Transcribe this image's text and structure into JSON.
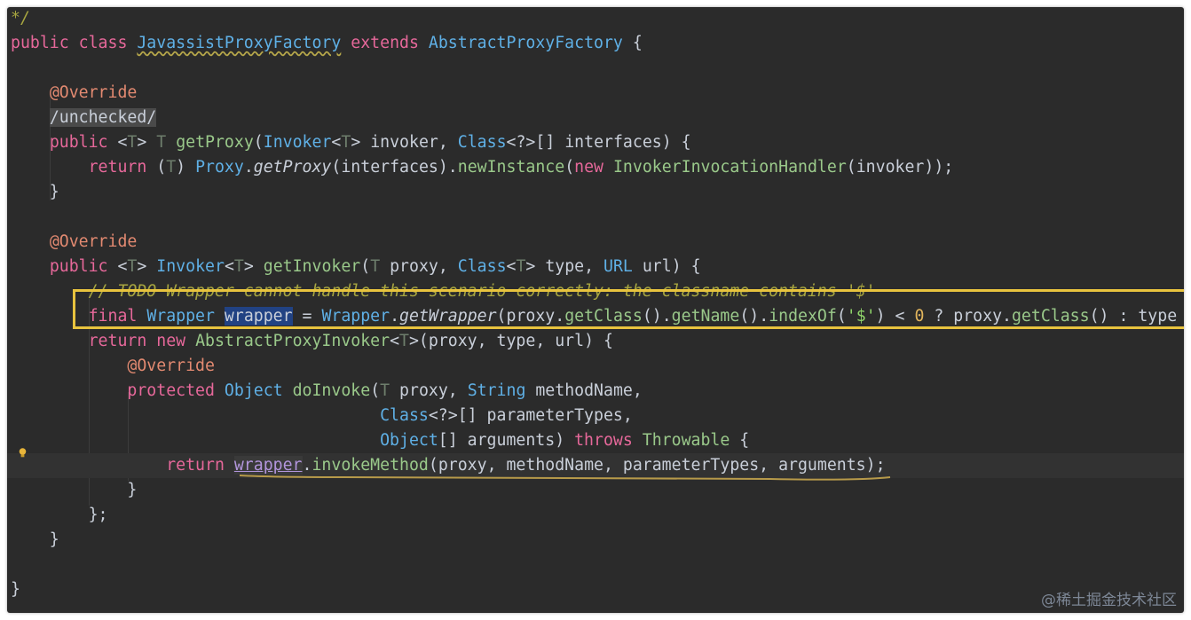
{
  "editor": {
    "lines": [
      {
        "id": "l0",
        "tokens": [
          {
            "c": "cmt",
            "t": "*/"
          }
        ]
      },
      {
        "id": "l1",
        "tokens": [
          {
            "c": "kw",
            "t": "public"
          },
          {
            "c": "pln",
            "t": " "
          },
          {
            "c": "kw",
            "t": "class"
          },
          {
            "c": "pln",
            "t": " "
          },
          {
            "c": "cwavy",
            "t": "JavassistProxyFactory"
          },
          {
            "c": "pln",
            "t": " "
          },
          {
            "c": "kw",
            "t": "extends"
          },
          {
            "c": "pln",
            "t": " "
          },
          {
            "c": "cls",
            "t": "AbstractProxyFactory"
          },
          {
            "c": "pln",
            "t": " {"
          }
        ]
      },
      {
        "id": "l2",
        "tokens": []
      },
      {
        "id": "l3",
        "tokens": [
          {
            "c": "pln",
            "t": "    "
          },
          {
            "c": "ann",
            "t": "@Override"
          }
        ]
      },
      {
        "id": "l4",
        "tokens": [
          {
            "c": "pln",
            "t": "    "
          },
          {
            "c": "boxed pln",
            "t": "/unchecked/"
          }
        ]
      },
      {
        "id": "l5",
        "tokens": [
          {
            "c": "pln",
            "t": "    "
          },
          {
            "c": "kw",
            "t": "public"
          },
          {
            "c": "pln",
            "t": " <"
          },
          {
            "c": "tp",
            "t": "T"
          },
          {
            "c": "pln",
            "t": "> "
          },
          {
            "c": "tp",
            "t": "T"
          },
          {
            "c": "pln",
            "t": " "
          },
          {
            "c": "fn",
            "t": "getProxy"
          },
          {
            "c": "pln",
            "t": "("
          },
          {
            "c": "cls",
            "t": "Invoker"
          },
          {
            "c": "pln",
            "t": "<"
          },
          {
            "c": "tp",
            "t": "T"
          },
          {
            "c": "pln",
            "t": "> invoker, "
          },
          {
            "c": "cls",
            "t": "Class"
          },
          {
            "c": "pln",
            "t": "<?>[] interfaces) {"
          }
        ]
      },
      {
        "id": "l6",
        "tokens": [
          {
            "c": "pln",
            "t": "        "
          },
          {
            "c": "kw",
            "t": "return"
          },
          {
            "c": "pln",
            "t": " ("
          },
          {
            "c": "tp",
            "t": "T"
          },
          {
            "c": "pln",
            "t": ") "
          },
          {
            "c": "cls",
            "t": "Proxy"
          },
          {
            "c": "pln",
            "t": "."
          },
          {
            "c": "pln st",
            "t": "getProxy"
          },
          {
            "c": "pln",
            "t": "(interfaces)."
          },
          {
            "c": "fn",
            "t": "newInstance"
          },
          {
            "c": "pln",
            "t": "("
          },
          {
            "c": "kw",
            "t": "new"
          },
          {
            "c": "pln",
            "t": " "
          },
          {
            "c": "fn",
            "t": "InvokerInvocationHandler"
          },
          {
            "c": "pln",
            "t": "(invoker));"
          }
        ]
      },
      {
        "id": "l7",
        "tokens": [
          {
            "c": "pln",
            "t": "    }"
          }
        ]
      },
      {
        "id": "l8",
        "tokens": []
      },
      {
        "id": "l9",
        "tokens": [
          {
            "c": "pln",
            "t": "    "
          },
          {
            "c": "ann",
            "t": "@Override"
          }
        ]
      },
      {
        "id": "l10",
        "tokens": [
          {
            "c": "pln",
            "t": "    "
          },
          {
            "c": "kw",
            "t": "public"
          },
          {
            "c": "pln",
            "t": " <"
          },
          {
            "c": "tp",
            "t": "T"
          },
          {
            "c": "pln",
            "t": "> "
          },
          {
            "c": "cls",
            "t": "Invoker"
          },
          {
            "c": "pln",
            "t": "<"
          },
          {
            "c": "tp",
            "t": "T"
          },
          {
            "c": "pln",
            "t": "> "
          },
          {
            "c": "fn",
            "t": "getInvoker"
          },
          {
            "c": "pln",
            "t": "("
          },
          {
            "c": "tp",
            "t": "T"
          },
          {
            "c": "pln",
            "t": " proxy, "
          },
          {
            "c": "cls",
            "t": "Class"
          },
          {
            "c": "pln",
            "t": "<"
          },
          {
            "c": "tp",
            "t": "T"
          },
          {
            "c": "pln",
            "t": "> type, "
          },
          {
            "c": "cls",
            "t": "URL"
          },
          {
            "c": "pln",
            "t": " url) {"
          }
        ]
      },
      {
        "id": "l11",
        "tokens": [
          {
            "c": "pln",
            "t": "        "
          },
          {
            "c": "cmt",
            "t": "// TODO Wrapper cannot handle this scenario correctly: the classname contains '$'"
          }
        ]
      },
      {
        "id": "l12",
        "tokens": [
          {
            "c": "pln",
            "t": "        "
          },
          {
            "c": "kw",
            "t": "final"
          },
          {
            "c": "pln",
            "t": " "
          },
          {
            "c": "cls",
            "t": "Wrapper"
          },
          {
            "c": "pln",
            "t": " "
          },
          {
            "c": "hl pln",
            "t": "wrapper"
          },
          {
            "c": "pln",
            "t": " = "
          },
          {
            "c": "cls",
            "t": "Wrapper"
          },
          {
            "c": "pln",
            "t": "."
          },
          {
            "c": "pln st",
            "t": "getWrapper"
          },
          {
            "c": "pln",
            "t": "(proxy."
          },
          {
            "c": "fn",
            "t": "getClass"
          },
          {
            "c": "pln",
            "t": "()."
          },
          {
            "c": "fn",
            "t": "getName"
          },
          {
            "c": "pln",
            "t": "()."
          },
          {
            "c": "fn",
            "t": "indexOf"
          },
          {
            "c": "pln",
            "t": "("
          },
          {
            "c": "str",
            "t": "'$'"
          },
          {
            "c": "pln",
            "t": ") < "
          },
          {
            "c": "num",
            "t": "0"
          },
          {
            "c": "pln",
            "t": " ? proxy."
          },
          {
            "c": "fn",
            "t": "getClass"
          },
          {
            "c": "pln",
            "t": "() : type"
          }
        ]
      },
      {
        "id": "l13",
        "tokens": [
          {
            "c": "pln",
            "t": "        "
          },
          {
            "c": "kw",
            "t": "return"
          },
          {
            "c": "pln",
            "t": " "
          },
          {
            "c": "kw",
            "t": "new"
          },
          {
            "c": "pln",
            "t": " "
          },
          {
            "c": "fn",
            "t": "AbstractProxyInvoker"
          },
          {
            "c": "pln",
            "t": "<"
          },
          {
            "c": "tp",
            "t": "T"
          },
          {
            "c": "pln",
            "t": ">(proxy, type, url) {"
          }
        ]
      },
      {
        "id": "l14",
        "tokens": [
          {
            "c": "pln",
            "t": "            "
          },
          {
            "c": "ann",
            "t": "@Override"
          }
        ]
      },
      {
        "id": "l15",
        "tokens": [
          {
            "c": "pln",
            "t": "            "
          },
          {
            "c": "kw",
            "t": "protected"
          },
          {
            "c": "pln",
            "t": " "
          },
          {
            "c": "cls",
            "t": "Object"
          },
          {
            "c": "pln",
            "t": " "
          },
          {
            "c": "fn",
            "t": "doInvoke"
          },
          {
            "c": "pln",
            "t": "("
          },
          {
            "c": "tp",
            "t": "T"
          },
          {
            "c": "pln",
            "t": " proxy, "
          },
          {
            "c": "cls",
            "t": "String"
          },
          {
            "c": "pln",
            "t": " methodName,"
          }
        ]
      },
      {
        "id": "l16",
        "tokens": [
          {
            "c": "pln",
            "t": "                                      "
          },
          {
            "c": "cls",
            "t": "Class"
          },
          {
            "c": "pln",
            "t": "<?>[] parameterTypes,"
          }
        ]
      },
      {
        "id": "l17",
        "tokens": [
          {
            "c": "pln",
            "t": "                                      "
          },
          {
            "c": "cls",
            "t": "Object"
          },
          {
            "c": "pln",
            "t": "[] arguments) "
          },
          {
            "c": "kw",
            "t": "throws"
          },
          {
            "c": "pln",
            "t": " "
          },
          {
            "c": "fn",
            "t": "Throwable"
          },
          {
            "c": "pln",
            "t": " {"
          }
        ]
      },
      {
        "id": "l18",
        "cur": true,
        "tokens": [
          {
            "c": "pln",
            "t": "                "
          },
          {
            "c": "kw",
            "t": "return"
          },
          {
            "c": "pln",
            "t": " "
          },
          {
            "c": "ulink",
            "t": "wrapper"
          },
          {
            "c": "pln",
            "t": "."
          },
          {
            "c": "fn",
            "t": "invokeMethod"
          },
          {
            "c": "pln",
            "t": "(proxy, methodName, parameterTypes, arguments);"
          }
        ]
      },
      {
        "id": "l19",
        "tokens": [
          {
            "c": "pln",
            "t": "            }"
          }
        ]
      },
      {
        "id": "l20",
        "tokens": [
          {
            "c": "pln",
            "t": "        };"
          }
        ]
      },
      {
        "id": "l21",
        "tokens": [
          {
            "c": "pln",
            "t": "    }"
          }
        ]
      },
      {
        "id": "l22",
        "tokens": []
      },
      {
        "id": "l23",
        "tokens": [
          {
            "c": "pln",
            "t": "}"
          }
        ]
      }
    ]
  },
  "watermark": "@稀土掘金技术社区",
  "icons": {
    "gutter": "lightbulb-icon"
  },
  "colors": {
    "highlight_box": "#e8c33e",
    "background": "#2b2b2b"
  }
}
